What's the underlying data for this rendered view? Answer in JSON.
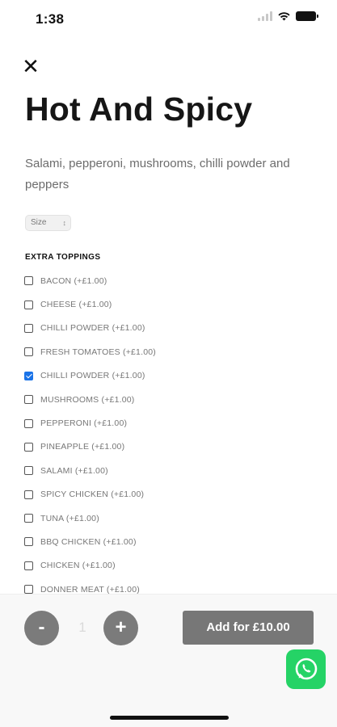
{
  "status_bar": {
    "time": "1:38",
    "icons": [
      "signal-icon",
      "wifi-icon",
      "battery-icon"
    ]
  },
  "header": {
    "close_icon": "close-icon",
    "close_glyph": "✕"
  },
  "product": {
    "title": "Hot And Spicy",
    "description": "Salami, pepperoni, mushrooms, chilli powder and peppers"
  },
  "size_select": {
    "value": "Size",
    "chevron_glyph": "↕"
  },
  "extras": {
    "heading": "EXTRA TOPPINGS",
    "items": [
      {
        "label": "BACON (+£1.00)",
        "checked": false
      },
      {
        "label": "CHEESE (+£1.00)",
        "checked": false
      },
      {
        "label": "CHILLI POWDER (+£1.00)",
        "checked": false
      },
      {
        "label": "FRESH TOMATOES (+£1.00)",
        "checked": false
      },
      {
        "label": "CHILLI POWDER (+£1.00)",
        "checked": true
      },
      {
        "label": "MUSHROOMS (+£1.00)",
        "checked": false
      },
      {
        "label": "PEPPERONI (+£1.00)",
        "checked": false
      },
      {
        "label": "PINEAPPLE (+£1.00)",
        "checked": false
      },
      {
        "label": "SALAMI (+£1.00)",
        "checked": false
      },
      {
        "label": "SPICY CHICKEN (+£1.00)",
        "checked": false
      },
      {
        "label": "TUNA (+£1.00)",
        "checked": false
      },
      {
        "label": "BBQ CHICKEN (+£1.00)",
        "checked": false
      },
      {
        "label": "CHICKEN (+£1.00)",
        "checked": false
      },
      {
        "label": "DONNER MEAT (+£1.00)",
        "checked": false
      }
    ]
  },
  "cart": {
    "minus_label": "-",
    "quantity": "1",
    "plus_label": "+",
    "add_label": "Add for £10.00"
  },
  "colors": {
    "checkbox_checked": "#1a73e8",
    "button_grey": "#777777",
    "whatsapp_green": "#25d366"
  },
  "floating": {
    "whatsapp_icon": "whatsapp-icon"
  }
}
